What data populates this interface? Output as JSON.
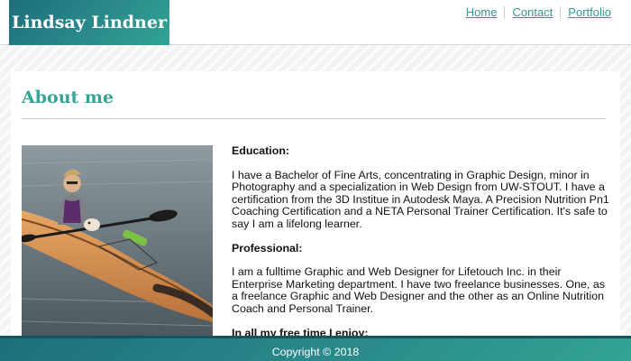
{
  "header": {
    "logo_text": "Lindsay Lindner",
    "nav": [
      {
        "label": "Home"
      },
      {
        "label": "Contact"
      },
      {
        "label": "Portfolio"
      }
    ]
  },
  "main": {
    "title": "About me",
    "photo_alt": "Woman with a small dog in a wooden kayak on a lake",
    "sections": [
      {
        "heading": "Education:",
        "body": "I have a Bachelor of Fine Arts, concentrating in Graphic Design, minor in Photography and a specialization in Web Design from UW-STOUT. I have a certification from the 3D Institue in Autodesk Maya. A Precision Nutrition Pn1 Coaching Certification and a NETA Personal Trainer Certification. It's safe to say I am a lifelong learner."
      },
      {
        "heading": "Professional:",
        "body": "I am a fulltime Graphic and Web Designer for Lifetouch Inc. in their Enterprise Marketing department. I have two freelance businesses. One, as a freelance Graphic and Web Designer and the other as an Online Nutrition Coach and Personal Trainer."
      },
      {
        "heading": "In all my free time I enjoy:",
        "body": ""
      }
    ]
  },
  "footer": {
    "copyright": "Copyright © 2018"
  },
  "colors": {
    "accent": "#35a493",
    "brand_gradient_start": "#1e6e7c",
    "brand_gradient_end": "#33a394"
  }
}
